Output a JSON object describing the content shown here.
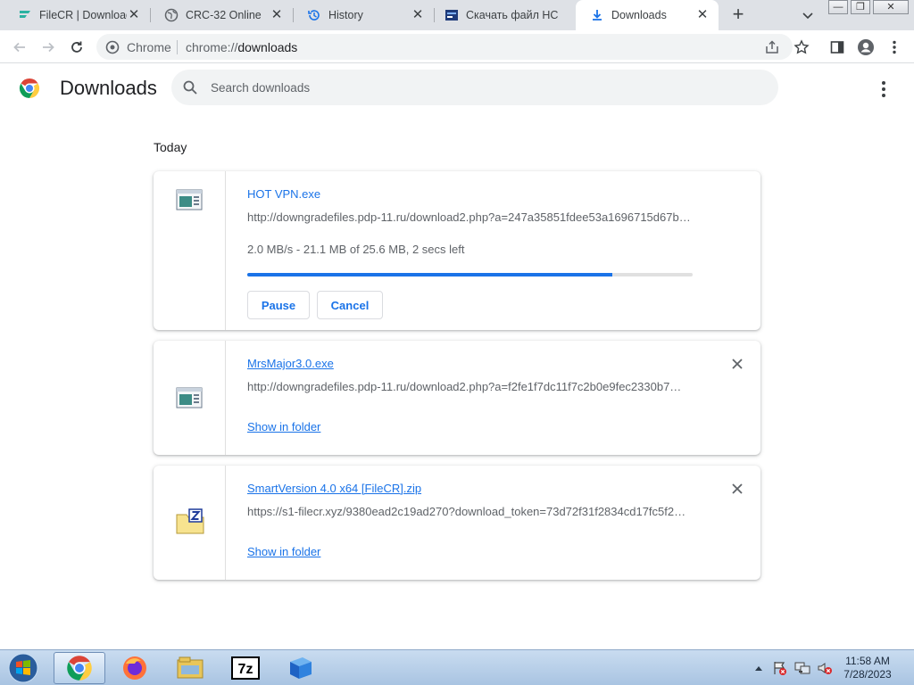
{
  "tabs": [
    {
      "title": "FileCR | Download",
      "icon": "filecr-icon",
      "active": false
    },
    {
      "title": "CRC-32 Online",
      "icon": "globe-icon",
      "active": false
    },
    {
      "title": "History",
      "icon": "history-icon",
      "active": false
    },
    {
      "title": "Скачать файл НС",
      "icon": "site-icon",
      "active": false
    },
    {
      "title": "Downloads",
      "icon": "download-icon",
      "active": true
    }
  ],
  "toolbar": {
    "omnibox_label": "Chrome",
    "url_scheme": "chrome://",
    "url_path": "downloads"
  },
  "downloads_page": {
    "title": "Downloads",
    "search_placeholder": "Search downloads",
    "section_label": "Today"
  },
  "items": [
    {
      "filename": "HOT VPN.exe",
      "url": "http://downgradefiles.pdp-11.ru/download2.php?a=247a35851fdee53a1696715d67b…",
      "status": "2.0 MB/s - 21.1 MB of 25.6 MB, 2 secs left",
      "progress": 0.82,
      "buttons": {
        "pause": "Pause",
        "cancel": "Cancel"
      },
      "icon": "executable-icon"
    },
    {
      "filename": "MrsMajor3.0.exe",
      "url": "http://downgradefiles.pdp-11.ru/download2.php?a=f2fe1f7dc11f7c2b0e9fec2330b7…",
      "link": "Show in folder",
      "icon": "executable-icon"
    },
    {
      "filename": "SmartVersion 4.0 x64 [FileCR].zip",
      "url": "https://s1-filecr.xyz/9380ead2c19ad270?download_token=73d72f31f2834cd17fc5f2…",
      "link": "Show in folder",
      "icon": "zip-archive-icon"
    }
  ],
  "taskbar": {
    "apps": [
      "chrome",
      "firefox",
      "file-explorer",
      "7-zip",
      "virtualbox"
    ],
    "time": "11:58 AM",
    "date": "7/28/2023"
  },
  "colors": {
    "accent": "#1a73e8",
    "tabstrip": "#dee1e6",
    "progress_track": "#e0e0e0"
  }
}
